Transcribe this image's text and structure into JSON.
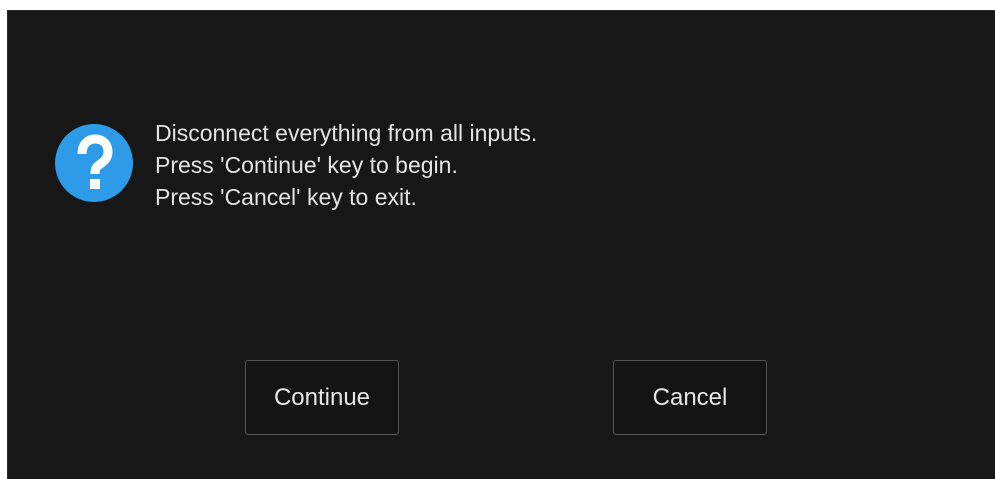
{
  "dialog": {
    "icon": "question-icon",
    "accent_color": "#2d9be8",
    "background_color": "#171717",
    "message_lines": [
      "Disconnect everything from all inputs.",
      "Press 'Continue' key to begin.",
      "Press 'Cancel' key to exit."
    ],
    "buttons": {
      "continue_label": "Continue",
      "cancel_label": "Cancel"
    }
  }
}
